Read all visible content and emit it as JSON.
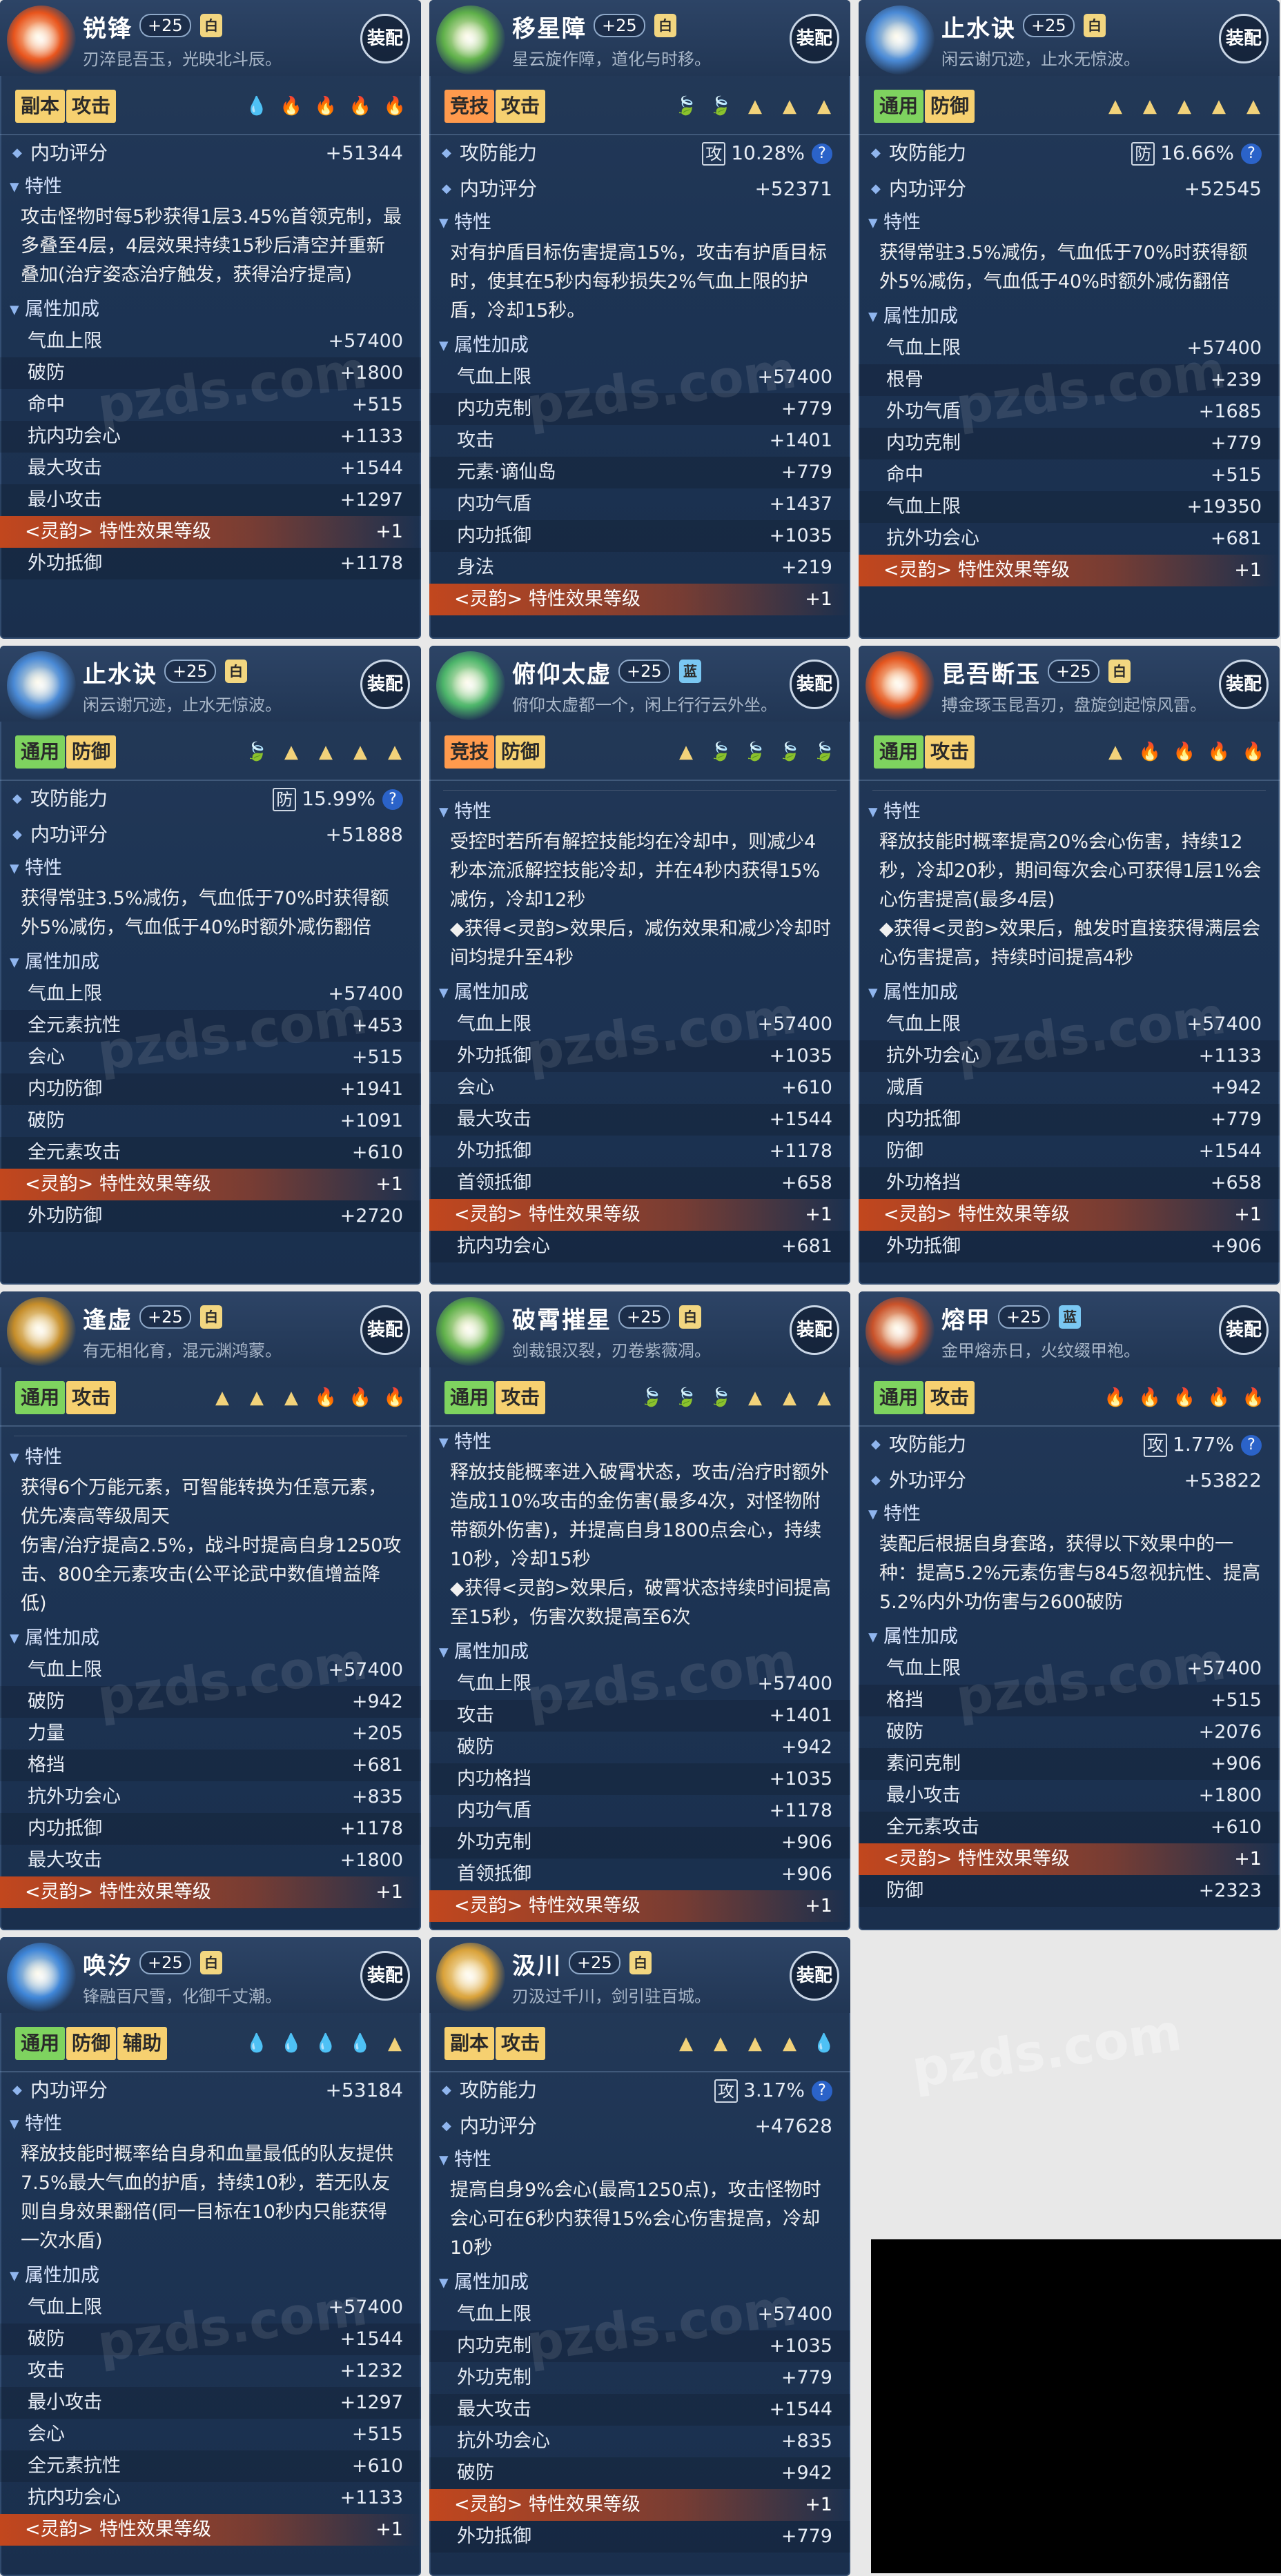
{
  "common": {
    "equip_label": "装配",
    "lingyun_label": "<灵韵> 特性效果等级",
    "attr_header": "属性加成",
    "trait_header": "特性",
    "watermark": "pzds.com"
  },
  "cards": [
    {
      "name": "锐锋",
      "level": "+25",
      "grade": "白",
      "desc": "刃淬昆吾玉，光映北斗辰。",
      "gem_color": "#e8541c",
      "tags": [
        {
          "t": "副本",
          "c": "yellow"
        },
        {
          "t": "攻击",
          "c": "yellow"
        }
      ],
      "slots": [
        {
          "g": "💧",
          "c": "#7bd0ff"
        },
        {
          "g": "🔥",
          "c": "#ff6a3a"
        },
        {
          "g": "🔥",
          "c": "#ff6a3a"
        },
        {
          "g": "🔥",
          "c": "#ff6a3a"
        },
        {
          "g": "🔥",
          "c": "#ff6a3a"
        }
      ],
      "top": [
        {
          "k": "内功评分",
          "v": "+51344"
        }
      ],
      "trait": "攻击怪物时每5秒获得1层3.45%首领克制，最多叠至4层，4层效果持续15秒后清空并重新叠加(治疗姿态治疗触发，获得治疗提高)",
      "attrs": [
        [
          "气血上限",
          "+57400"
        ],
        [
          "破防",
          "+1800"
        ],
        [
          "命中",
          "+515"
        ],
        [
          "抗内功会心",
          "+1133"
        ],
        [
          "最大攻击",
          "+1544"
        ],
        [
          "最小攻击",
          "+1297"
        ]
      ],
      "lingyun": "+1",
      "after": [
        [
          "外功抵御",
          "+1178"
        ]
      ]
    },
    {
      "name": "移星障",
      "level": "+25",
      "grade": "白",
      "desc": "星云旋作障，道化与时移。",
      "gem_color": "#5fb04a",
      "tags": [
        {
          "t": "竞技",
          "c": "orange"
        },
        {
          "t": "攻击",
          "c": "yellow"
        }
      ],
      "slots": [
        {
          "g": "🍃",
          "c": "#6fe07a"
        },
        {
          "g": "🍃",
          "c": "#6fe07a"
        },
        {
          "g": "▲",
          "c": "#f2d27a"
        },
        {
          "g": "▲",
          "c": "#f2d27a"
        },
        {
          "g": "▲",
          "c": "#f2d27a"
        }
      ],
      "power": {
        "label": "攻防能力",
        "box": "攻",
        "value": "10.28%"
      },
      "top": [
        {
          "k": "内功评分",
          "v": "+52371"
        }
      ],
      "trait": "对有护盾目标伤害提高15%，攻击有护盾目标时，使其在5秒内每秒损失2%气血上限的护盾，冷却15秒。",
      "attrs": [
        [
          "气血上限",
          "+57400"
        ],
        [
          "内功克制",
          "+779"
        ],
        [
          "攻击",
          "+1401"
        ],
        [
          "元素·谪仙岛",
          "+779"
        ],
        [
          "内功气盾",
          "+1437"
        ],
        [
          "内功抵御",
          "+1035"
        ],
        [
          "身法",
          "+219"
        ]
      ],
      "lingyun": "+1",
      "after": []
    },
    {
      "name": "止水诀",
      "level": "+25",
      "grade": "白",
      "desc": "闲云谢冗迹，止水无惊波。",
      "gem_color": "#4a8ad6",
      "tags": [
        {
          "t": "通用",
          "c": "green"
        },
        {
          "t": "防御",
          "c": "yellow"
        }
      ],
      "slots": [
        {
          "g": "▲",
          "c": "#f2d27a"
        },
        {
          "g": "▲",
          "c": "#f2d27a"
        },
        {
          "g": "▲",
          "c": "#f2d27a"
        },
        {
          "g": "▲",
          "c": "#f2d27a"
        },
        {
          "g": "▲",
          "c": "#f2d27a"
        }
      ],
      "power": {
        "label": "攻防能力",
        "box": "防",
        "value": "16.66%"
      },
      "top": [
        {
          "k": "内功评分",
          "v": "+52545"
        }
      ],
      "trait": "获得常驻3.5%减伤，气血低于70%时获得额外5%减伤，气血低于40%时额外减伤翻倍",
      "attrs": [
        [
          "气血上限",
          "+57400"
        ],
        [
          "根骨",
          "+239"
        ],
        [
          "外功气盾",
          "+1685"
        ],
        [
          "内功克制",
          "+779"
        ],
        [
          "命中",
          "+515"
        ],
        [
          "气血上限",
          "+19350"
        ],
        [
          "抗外功会心",
          "+681"
        ]
      ],
      "lingyun": "+1",
      "after": []
    },
    {
      "name": "止水诀",
      "level": "+25",
      "grade": "白",
      "desc": "闲云谢冗迹，止水无惊波。",
      "gem_color": "#4a8ad6",
      "tags": [
        {
          "t": "通用",
          "c": "green"
        },
        {
          "t": "防御",
          "c": "yellow"
        }
      ],
      "slots": [
        {
          "g": "🍃",
          "c": "#6fe07a"
        },
        {
          "g": "▲",
          "c": "#f2d27a"
        },
        {
          "g": "▲",
          "c": "#f2d27a"
        },
        {
          "g": "▲",
          "c": "#f2d27a"
        },
        {
          "g": "▲",
          "c": "#f2d27a"
        }
      ],
      "power": {
        "label": "攻防能力",
        "box": "防",
        "value": "15.99%"
      },
      "top": [
        {
          "k": "内功评分",
          "v": "+51888"
        }
      ],
      "trait": "获得常驻3.5%减伤，气血低于70%时获得额外5%减伤，气血低于40%时额外减伤翻倍",
      "attrs": [
        [
          "气血上限",
          "+57400"
        ],
        [
          "全元素抗性",
          "+453"
        ],
        [
          "会心",
          "+515"
        ],
        [
          "内功防御",
          "+1941"
        ],
        [
          "破防",
          "+1091"
        ],
        [
          "全元素攻击",
          "+610"
        ]
      ],
      "lingyun": "+1",
      "after": [
        [
          "外功防御",
          "+2720"
        ]
      ]
    },
    {
      "name": "俯仰太虚",
      "level": "+25",
      "grade": "蓝",
      "desc": "俯仰太虚都一个，闲上行行云外坐。",
      "gem_color": "#4cb56a",
      "tags": [
        {
          "t": "竞技",
          "c": "orange"
        },
        {
          "t": "防御",
          "c": "yellow"
        }
      ],
      "slots": [
        {
          "g": "▲",
          "c": "#f2d27a"
        },
        {
          "g": "🍃",
          "c": "#6fe07a"
        },
        {
          "g": "🍃",
          "c": "#6fe07a"
        },
        {
          "g": "🍃",
          "c": "#6fe07a"
        },
        {
          "g": "🍃",
          "c": "#6fe07a"
        }
      ],
      "partial": true,
      "trait": "受控时若所有解控技能均在冷却中，则减少4秒本流派解控技能冷却，并在4秒内获得15%减伤，冷却12秒\n◆获得<灵韵>效果后，减伤效果和减少冷却时间均提升至4秒",
      "attrs": [
        [
          "气血上限",
          "+57400"
        ],
        [
          "外功抵御",
          "+1035"
        ],
        [
          "会心",
          "+610"
        ],
        [
          "最大攻击",
          "+1544"
        ],
        [
          "外功抵御",
          "+1178"
        ],
        [
          "首领抵御",
          "+658"
        ]
      ],
      "lingyun": "+1",
      "after": [
        [
          "抗内功会心",
          "+681"
        ]
      ]
    },
    {
      "name": "昆吾断玉",
      "level": "+25",
      "grade": "白",
      "desc": "搏金琢玉昆吾刃，盘旋剑起惊风雷。",
      "gem_color": "#e4551e",
      "tags": [
        {
          "t": "通用",
          "c": "green"
        },
        {
          "t": "攻击",
          "c": "yellow"
        }
      ],
      "slots": [
        {
          "g": "▲",
          "c": "#f2d27a"
        },
        {
          "g": "🔥",
          "c": "#ff6a3a"
        },
        {
          "g": "🔥",
          "c": "#ff6a3a"
        },
        {
          "g": "🔥",
          "c": "#ff6a3a"
        },
        {
          "g": "🔥",
          "c": "#ff6a3a"
        }
      ],
      "partial": true,
      "trait": "释放技能时概率提高20%会心伤害，持续12秒，冷却20秒，期间每次会心可获得1层1%会心伤害提高(最多4层)\n◆获得<灵韵>效果后，触发时直接获得满层会心伤害提高，持续时间提高4秒",
      "attrs": [
        [
          "气血上限",
          "+57400"
        ],
        [
          "抗外功会心",
          "+1133"
        ],
        [
          "减盾",
          "+942"
        ],
        [
          "内功抵御",
          "+779"
        ],
        [
          "防御",
          "+1544"
        ],
        [
          "外功格挡",
          "+658"
        ]
      ],
      "lingyun": "+1",
      "after": [
        [
          "外功抵御",
          "+906"
        ]
      ]
    },
    {
      "name": "逢虚",
      "level": "+25",
      "grade": "白",
      "desc": "有无相化育，混元渊鸿蒙。",
      "gem_color": "#c58d2a",
      "tags": [
        {
          "t": "通用",
          "c": "green"
        },
        {
          "t": "攻击",
          "c": "yellow"
        }
      ],
      "slots": [
        {
          "g": "▲",
          "c": "#f2d27a"
        },
        {
          "g": "▲",
          "c": "#f2d27a"
        },
        {
          "g": "▲",
          "c": "#f2d27a"
        },
        {
          "g": "🔥",
          "c": "#ff6a3a"
        },
        {
          "g": "🔥",
          "c": "#ff6a3a"
        },
        {
          "g": "🔥",
          "c": "#ff6a3a"
        }
      ],
      "partial": true,
      "trait": "获得6个万能元素，可智能转换为任意元素，优先凑高等级周天\n伤害/治疗提高2.5%，战斗时提高自身1250攻击、800全元素攻击(公平论武中数值增益降低)",
      "attrs": [
        [
          "气血上限",
          "+57400"
        ],
        [
          "破防",
          "+942"
        ],
        [
          "力量",
          "+205"
        ],
        [
          "格挡",
          "+681"
        ],
        [
          "抗外功会心",
          "+835"
        ],
        [
          "内功抵御",
          "+1178"
        ],
        [
          "最大攻击",
          "+1800"
        ]
      ],
      "lingyun": "+1",
      "after": []
    },
    {
      "name": "破霄摧星",
      "level": "+25",
      "grade": "白",
      "desc": "剑裁银汉裂，刃卷紫薇凋。",
      "gem_color": "#5fb04a",
      "tags": [
        {
          "t": "通用",
          "c": "green"
        },
        {
          "t": "攻击",
          "c": "yellow"
        }
      ],
      "slots": [
        {
          "g": "🍃",
          "c": "#6fe07a"
        },
        {
          "g": "🍃",
          "c": "#6fe07a"
        },
        {
          "g": "🍃",
          "c": "#6fe07a"
        },
        {
          "g": "▲",
          "c": "#f2d27a"
        },
        {
          "g": "▲",
          "c": "#f2d27a"
        },
        {
          "g": "▲",
          "c": "#f2d27a"
        }
      ],
      "trait": "释放技能概率进入破霄状态，攻击/治疗时额外造成110%攻击的金伤害(最多4次，对怪物附带额外伤害)，并提高自身1800点会心，持续10秒，冷却15秒\n◆获得<灵韵>效果后，破霄状态持续时间提高至15秒，伤害次数提高至6次",
      "attrs": [
        [
          "气血上限",
          "+57400"
        ],
        [
          "攻击",
          "+1401"
        ],
        [
          "破防",
          "+942"
        ],
        [
          "内功格挡",
          "+1035"
        ],
        [
          "内功气盾",
          "+1178"
        ],
        [
          "外功克制",
          "+906"
        ],
        [
          "首领抵御",
          "+906"
        ]
      ],
      "lingyun": "+1",
      "after": []
    },
    {
      "name": "熔甲",
      "level": "+25",
      "grade": "蓝",
      "desc": "金甲熔赤日，火纹缀甲袍。",
      "gem_color": "#c9522a",
      "tags": [
        {
          "t": "通用",
          "c": "green"
        },
        {
          "t": "攻击",
          "c": "yellow"
        }
      ],
      "slots": [
        {
          "g": "🔥",
          "c": "#ff6a3a"
        },
        {
          "g": "🔥",
          "c": "#ff6a3a"
        },
        {
          "g": "🔥",
          "c": "#ff6a3a"
        },
        {
          "g": "🔥",
          "c": "#ff6a3a"
        },
        {
          "g": "🔥",
          "c": "#ff6a3a"
        }
      ],
      "power": {
        "label": "攻防能力",
        "box": "攻",
        "value": "1.77%"
      },
      "top": [
        {
          "k": "外功评分",
          "v": "+53822"
        }
      ],
      "trait": "装配后根据自身套路，获得以下效果中的一种：提高5.2%元素伤害与845忽视抗性、提高5.2%内外功伤害与2600破防",
      "attrs": [
        [
          "气血上限",
          "+57400"
        ],
        [
          "格挡",
          "+515"
        ],
        [
          "破防",
          "+2076"
        ],
        [
          "素问克制",
          "+906"
        ],
        [
          "最小攻击",
          "+1800"
        ],
        [
          "全元素攻击",
          "+610"
        ]
      ],
      "lingyun": "+1",
      "after": [
        [
          "防御",
          "+2323"
        ]
      ]
    },
    {
      "name": "唤汐",
      "level": "+25",
      "grade": "白",
      "desc": "锋融百尺雪，化御千丈潮。",
      "gem_color": "#3f86d8",
      "tags": [
        {
          "t": "通用",
          "c": "green"
        },
        {
          "t": "防御",
          "c": "yellow"
        },
        {
          "t": "辅助",
          "c": "yellow"
        }
      ],
      "slots": [
        {
          "g": "💧",
          "c": "#7bd0ff"
        },
        {
          "g": "💧",
          "c": "#7bd0ff"
        },
        {
          "g": "💧",
          "c": "#7bd0ff"
        },
        {
          "g": "💧",
          "c": "#7bd0ff"
        },
        {
          "g": "▲",
          "c": "#f2d27a"
        }
      ],
      "top": [
        {
          "k": "内功评分",
          "v": "+53184"
        }
      ],
      "trait": "释放技能时概率给自身和血量最低的队友提供7.5%最大气血的护盾，持续10秒，若无队友则自身效果翻倍(同一目标在10秒内只能获得一次水盾)",
      "attrs": [
        [
          "气血上限",
          "+57400"
        ],
        [
          "破防",
          "+1544"
        ],
        [
          "攻击",
          "+1232"
        ],
        [
          "最小攻击",
          "+1297"
        ],
        [
          "会心",
          "+515"
        ],
        [
          "全元素抗性",
          "+610"
        ],
        [
          "抗内功会心",
          "+1133"
        ]
      ],
      "lingyun": "+1",
      "after": []
    },
    {
      "name": "汲川",
      "level": "+25",
      "grade": "白",
      "desc": "刃汲过千川，剑引驻百城。",
      "gem_color": "#d9a23a",
      "tags": [
        {
          "t": "副本",
          "c": "yellow"
        },
        {
          "t": "攻击",
          "c": "yellow"
        }
      ],
      "slots": [
        {
          "g": "▲",
          "c": "#f2d27a"
        },
        {
          "g": "▲",
          "c": "#f2d27a"
        },
        {
          "g": "▲",
          "c": "#f2d27a"
        },
        {
          "g": "▲",
          "c": "#f2d27a"
        },
        {
          "g": "💧",
          "c": "#7bd0ff"
        }
      ],
      "power": {
        "label": "攻防能力",
        "box": "攻",
        "value": "3.17%"
      },
      "top": [
        {
          "k": "内功评分",
          "v": "+47628"
        }
      ],
      "trait": "提高自身9%会心(最高1250点)，攻击怪物时会心可在6秒内获得15%会心伤害提高，冷却10秒",
      "attrs": [
        [
          "气血上限",
          "+57400"
        ],
        [
          "内功克制",
          "+1035"
        ],
        [
          "外功克制",
          "+779"
        ],
        [
          "最大攻击",
          "+1544"
        ],
        [
          "抗外功会心",
          "+835"
        ],
        [
          "破防",
          "+942"
        ]
      ],
      "lingyun": "+1",
      "after": [
        [
          "外功抵御",
          "+779"
        ]
      ]
    }
  ]
}
